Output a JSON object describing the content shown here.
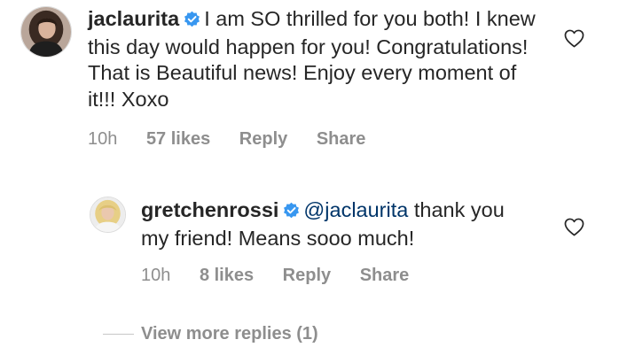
{
  "comment1": {
    "username": "jaclaurita",
    "text": "I am SO thrilled for you both! I knew this day would happen for you! Congratulations! That is Beautiful news! Enjoy every moment of it!!! Xoxo",
    "time": "10h",
    "likes": "57 likes",
    "reply_label": "Reply",
    "share_label": "Share"
  },
  "comment2": {
    "username": "gretchenrossi",
    "mention": "@jaclaurita",
    "text": "thank you my friend! Means sooo much!",
    "time": "10h",
    "likes": "8 likes",
    "reply_label": "Reply",
    "share_label": "Share"
  },
  "view_more": {
    "label": "View more replies (1)"
  },
  "colors": {
    "verified": "#3897f0",
    "mention": "#003569",
    "muted": "#8e8e8e",
    "text": "#262626"
  },
  "icons": {
    "verified": "verified-badge-icon",
    "like": "heart-icon"
  }
}
